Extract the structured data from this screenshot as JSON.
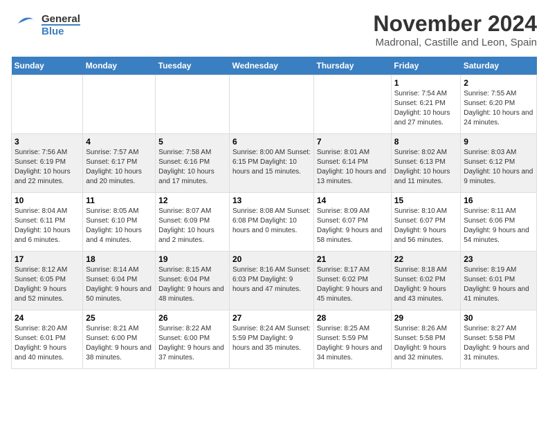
{
  "logo": {
    "general": "General",
    "blue": "Blue"
  },
  "title": "November 2024",
  "subtitle": "Madronal, Castille and Leon, Spain",
  "weekdays": [
    "Sunday",
    "Monday",
    "Tuesday",
    "Wednesday",
    "Thursday",
    "Friday",
    "Saturday"
  ],
  "weeks": [
    [
      {
        "day": "",
        "detail": ""
      },
      {
        "day": "",
        "detail": ""
      },
      {
        "day": "",
        "detail": ""
      },
      {
        "day": "",
        "detail": ""
      },
      {
        "day": "",
        "detail": ""
      },
      {
        "day": "1",
        "detail": "Sunrise: 7:54 AM\nSunset: 6:21 PM\nDaylight: 10 hours and 27 minutes."
      },
      {
        "day": "2",
        "detail": "Sunrise: 7:55 AM\nSunset: 6:20 PM\nDaylight: 10 hours and 24 minutes."
      }
    ],
    [
      {
        "day": "3",
        "detail": "Sunrise: 7:56 AM\nSunset: 6:19 PM\nDaylight: 10 hours and 22 minutes."
      },
      {
        "day": "4",
        "detail": "Sunrise: 7:57 AM\nSunset: 6:17 PM\nDaylight: 10 hours and 20 minutes."
      },
      {
        "day": "5",
        "detail": "Sunrise: 7:58 AM\nSunset: 6:16 PM\nDaylight: 10 hours and 17 minutes."
      },
      {
        "day": "6",
        "detail": "Sunrise: 8:00 AM\nSunset: 6:15 PM\nDaylight: 10 hours and 15 minutes."
      },
      {
        "day": "7",
        "detail": "Sunrise: 8:01 AM\nSunset: 6:14 PM\nDaylight: 10 hours and 13 minutes."
      },
      {
        "day": "8",
        "detail": "Sunrise: 8:02 AM\nSunset: 6:13 PM\nDaylight: 10 hours and 11 minutes."
      },
      {
        "day": "9",
        "detail": "Sunrise: 8:03 AM\nSunset: 6:12 PM\nDaylight: 10 hours and 9 minutes."
      }
    ],
    [
      {
        "day": "10",
        "detail": "Sunrise: 8:04 AM\nSunset: 6:11 PM\nDaylight: 10 hours and 6 minutes."
      },
      {
        "day": "11",
        "detail": "Sunrise: 8:05 AM\nSunset: 6:10 PM\nDaylight: 10 hours and 4 minutes."
      },
      {
        "day": "12",
        "detail": "Sunrise: 8:07 AM\nSunset: 6:09 PM\nDaylight: 10 hours and 2 minutes."
      },
      {
        "day": "13",
        "detail": "Sunrise: 8:08 AM\nSunset: 6:08 PM\nDaylight: 10 hours and 0 minutes."
      },
      {
        "day": "14",
        "detail": "Sunrise: 8:09 AM\nSunset: 6:07 PM\nDaylight: 9 hours and 58 minutes."
      },
      {
        "day": "15",
        "detail": "Sunrise: 8:10 AM\nSunset: 6:07 PM\nDaylight: 9 hours and 56 minutes."
      },
      {
        "day": "16",
        "detail": "Sunrise: 8:11 AM\nSunset: 6:06 PM\nDaylight: 9 hours and 54 minutes."
      }
    ],
    [
      {
        "day": "17",
        "detail": "Sunrise: 8:12 AM\nSunset: 6:05 PM\nDaylight: 9 hours and 52 minutes."
      },
      {
        "day": "18",
        "detail": "Sunrise: 8:14 AM\nSunset: 6:04 PM\nDaylight: 9 hours and 50 minutes."
      },
      {
        "day": "19",
        "detail": "Sunrise: 8:15 AM\nSunset: 6:04 PM\nDaylight: 9 hours and 48 minutes."
      },
      {
        "day": "20",
        "detail": "Sunrise: 8:16 AM\nSunset: 6:03 PM\nDaylight: 9 hours and 47 minutes."
      },
      {
        "day": "21",
        "detail": "Sunrise: 8:17 AM\nSunset: 6:02 PM\nDaylight: 9 hours and 45 minutes."
      },
      {
        "day": "22",
        "detail": "Sunrise: 8:18 AM\nSunset: 6:02 PM\nDaylight: 9 hours and 43 minutes."
      },
      {
        "day": "23",
        "detail": "Sunrise: 8:19 AM\nSunset: 6:01 PM\nDaylight: 9 hours and 41 minutes."
      }
    ],
    [
      {
        "day": "24",
        "detail": "Sunrise: 8:20 AM\nSunset: 6:01 PM\nDaylight: 9 hours and 40 minutes."
      },
      {
        "day": "25",
        "detail": "Sunrise: 8:21 AM\nSunset: 6:00 PM\nDaylight: 9 hours and 38 minutes."
      },
      {
        "day": "26",
        "detail": "Sunrise: 8:22 AM\nSunset: 6:00 PM\nDaylight: 9 hours and 37 minutes."
      },
      {
        "day": "27",
        "detail": "Sunrise: 8:24 AM\nSunset: 5:59 PM\nDaylight: 9 hours and 35 minutes."
      },
      {
        "day": "28",
        "detail": "Sunrise: 8:25 AM\nSunset: 5:59 PM\nDaylight: 9 hours and 34 minutes."
      },
      {
        "day": "29",
        "detail": "Sunrise: 8:26 AM\nSunset: 5:58 PM\nDaylight: 9 hours and 32 minutes."
      },
      {
        "day": "30",
        "detail": "Sunrise: 8:27 AM\nSunset: 5:58 PM\nDaylight: 9 hours and 31 minutes."
      }
    ]
  ]
}
